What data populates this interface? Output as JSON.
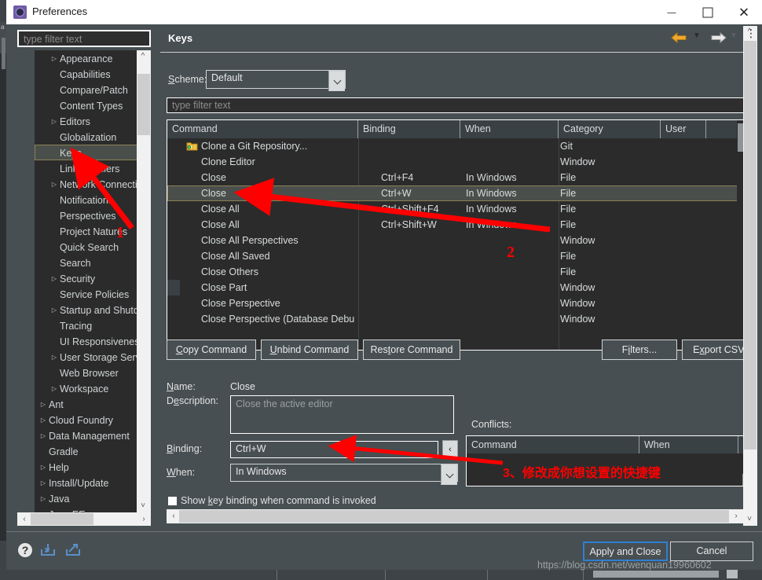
{
  "window": {
    "title": "Preferences",
    "icon": "preferences-icon",
    "minimize": "minimize-icon",
    "maximize": "maximize-icon",
    "close": "close-icon"
  },
  "left": {
    "filter_placeholder": "type filter text",
    "tree": [
      {
        "label": "Appearance",
        "depth": 2,
        "expandable": true,
        "selected": false
      },
      {
        "label": "Capabilities",
        "depth": 2,
        "expandable": false,
        "selected": false
      },
      {
        "label": "Compare/Patch",
        "depth": 2,
        "expandable": false,
        "selected": false
      },
      {
        "label": "Content Types",
        "depth": 2,
        "expandable": false,
        "selected": false
      },
      {
        "label": "Editors",
        "depth": 2,
        "expandable": true,
        "selected": false
      },
      {
        "label": "Globalization",
        "depth": 2,
        "expandable": false,
        "selected": false
      },
      {
        "label": "Keys",
        "depth": 2,
        "expandable": false,
        "selected": true
      },
      {
        "label": "Link Handlers",
        "depth": 2,
        "expandable": false,
        "selected": false
      },
      {
        "label": "Network Connectio",
        "depth": 2,
        "expandable": true,
        "selected": false
      },
      {
        "label": "Notifications",
        "depth": 2,
        "expandable": false,
        "selected": false
      },
      {
        "label": "Perspectives",
        "depth": 2,
        "expandable": false,
        "selected": false
      },
      {
        "label": "Project Natures",
        "depth": 2,
        "expandable": false,
        "selected": false
      },
      {
        "label": "Quick Search",
        "depth": 2,
        "expandable": false,
        "selected": false
      },
      {
        "label": "Search",
        "depth": 2,
        "expandable": false,
        "selected": false
      },
      {
        "label": "Security",
        "depth": 2,
        "expandable": true,
        "selected": false
      },
      {
        "label": "Service Policies",
        "depth": 2,
        "expandable": false,
        "selected": false
      },
      {
        "label": "Startup and Shutdo",
        "depth": 2,
        "expandable": true,
        "selected": false
      },
      {
        "label": "Tracing",
        "depth": 2,
        "expandable": false,
        "selected": false
      },
      {
        "label": "UI Responsiveness",
        "depth": 2,
        "expandable": false,
        "selected": false
      },
      {
        "label": "User Storage Servic",
        "depth": 2,
        "expandable": true,
        "selected": false
      },
      {
        "label": "Web Browser",
        "depth": 2,
        "expandable": false,
        "selected": false
      },
      {
        "label": "Workspace",
        "depth": 2,
        "expandable": true,
        "selected": false
      },
      {
        "label": "Ant",
        "depth": 1,
        "expandable": true,
        "selected": false
      },
      {
        "label": "Cloud Foundry",
        "depth": 1,
        "expandable": true,
        "selected": false
      },
      {
        "label": "Data Management",
        "depth": 1,
        "expandable": true,
        "selected": false
      },
      {
        "label": "Gradle",
        "depth": 1,
        "expandable": false,
        "selected": false
      },
      {
        "label": "Help",
        "depth": 1,
        "expandable": true,
        "selected": false
      },
      {
        "label": "Install/Update",
        "depth": 1,
        "expandable": true,
        "selected": false
      },
      {
        "label": "Java",
        "depth": 1,
        "expandable": true,
        "selected": false
      },
      {
        "label": "Java EE",
        "depth": 1,
        "expandable": true,
        "selected": false
      }
    ]
  },
  "page": {
    "title": "Keys",
    "nav_back": "back-arrow-icon",
    "nav_forward": "forward-arrow-icon",
    "menu": "view-menu-icon",
    "scheme_label": "Scheme:",
    "scheme_value": "Default",
    "table_filter_placeholder": "type filter text"
  },
  "table": {
    "columns": [
      "Command",
      "Binding",
      "When",
      "Category",
      "User"
    ],
    "sort_column": "Command",
    "rows": [
      {
        "command": "Clone a Git Repository...",
        "binding": "",
        "when": "",
        "category": "Git",
        "user": "",
        "icon": "git-repo-icon",
        "selected": false
      },
      {
        "command": "Clone Editor",
        "binding": "",
        "when": "",
        "category": "Window",
        "user": "",
        "icon": "",
        "selected": false
      },
      {
        "command": "Close",
        "binding": "Ctrl+F4",
        "when": "In Windows",
        "category": "File",
        "user": "",
        "icon": "",
        "selected": false
      },
      {
        "command": "Close",
        "binding": "Ctrl+W",
        "when": "In Windows",
        "category": "File",
        "user": "",
        "icon": "",
        "selected": true
      },
      {
        "command": "Close All",
        "binding": "Ctrl+Shift+F4",
        "when": "In Windows",
        "category": "File",
        "user": "",
        "icon": "",
        "selected": false
      },
      {
        "command": "Close All",
        "binding": "Ctrl+Shift+W",
        "when": "In Windows",
        "category": "File",
        "user": "",
        "icon": "",
        "selected": false
      },
      {
        "command": "Close All Perspectives",
        "binding": "",
        "when": "",
        "category": "Window",
        "user": "",
        "icon": "",
        "selected": false
      },
      {
        "command": "Close All Saved",
        "binding": "",
        "when": "",
        "category": "File",
        "user": "",
        "icon": "",
        "selected": false
      },
      {
        "command": "Close Others",
        "binding": "",
        "when": "",
        "category": "File",
        "user": "",
        "icon": "",
        "selected": false
      },
      {
        "command": "Close Part",
        "binding": "",
        "when": "",
        "category": "Window",
        "user": "",
        "icon": "",
        "selected": false
      },
      {
        "command": "Close Perspective",
        "binding": "",
        "when": "",
        "category": "Window",
        "user": "",
        "icon": "",
        "selected": false
      },
      {
        "command": "Close Perspective (Database Debu",
        "binding": "",
        "when": "",
        "category": "Window",
        "user": "",
        "icon": "",
        "selected": false
      }
    ]
  },
  "actions": {
    "copy_command": "Copy Command",
    "unbind_command": "Unbind Command",
    "restore_command": "Restore Command",
    "filters": "Filters...",
    "export_csv": "Export CSV."
  },
  "details": {
    "name_label": "Name:",
    "name_value": "Close",
    "description_label": "Description:",
    "description_value": "Close the active editor",
    "binding_label": "Binding:",
    "binding_value": "Ctrl+W",
    "binding_button": "‹",
    "when_label": "When:",
    "when_value": "In Windows",
    "show_binding_checkbox": "Show key binding when command is invoked",
    "show_binding_checked": false
  },
  "conflicts": {
    "label": "Conflicts:",
    "columns": [
      "Command",
      "When"
    ],
    "rows": []
  },
  "footer": {
    "help_icon": "help-icon",
    "import_icon": "import-icon",
    "export_icon": "export-icon",
    "apply_and_close": "Apply and Close",
    "cancel": "Cancel",
    "watermark": "https://blog.csdn.net/wenquan19960602"
  },
  "annotations": [
    {
      "id": "1",
      "text": "1"
    },
    {
      "id": "2",
      "text": "2"
    },
    {
      "id": "3",
      "text": "3、修改成你想设置的快捷键"
    }
  ],
  "colors": {
    "dialog_bg": "#474f52",
    "tree_bg": "#2b2b2b",
    "selection_border": "#8a8255",
    "annotation_red": "#ff0000",
    "focus_blue": "#2f7fd1"
  }
}
